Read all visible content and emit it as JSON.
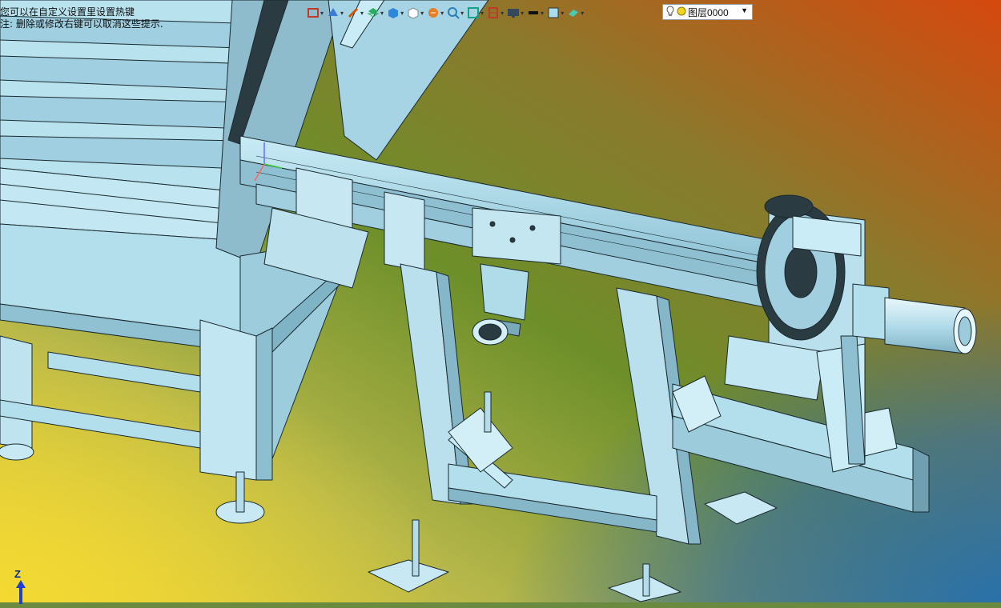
{
  "hint": {
    "line1": "您可以在自定义设置里设置热键",
    "line2": "注: 删除或修改右键可以取消这些提示."
  },
  "toolbar": {
    "items": [
      {
        "name": "render-mode-icon",
        "color": "#c0392b"
      },
      {
        "name": "view-orient-icon",
        "color": "#3a7bd5"
      },
      {
        "name": "sketch-pen-icon",
        "color": "#d35400"
      },
      {
        "name": "layer-stack-icon",
        "color": "#27ae60"
      },
      {
        "name": "solid-cube-icon",
        "color": "#2e86de"
      },
      {
        "name": "wire-cube-icon",
        "color": "#7f8c8d"
      },
      {
        "name": "filter-icon",
        "color": "#e67e22"
      },
      {
        "name": "zoom-fit-icon",
        "color": "#2980b9"
      },
      {
        "name": "zoom-box-icon",
        "color": "#16a085"
      },
      {
        "name": "section-view-icon",
        "color": "#c0392b"
      },
      {
        "name": "display-monitor-icon",
        "color": "#34495e"
      },
      {
        "name": "line-style-icon",
        "color": "#111111"
      },
      {
        "name": "color-swatch-icon",
        "color": "#a9dcef"
      },
      {
        "name": "material-icon",
        "color": "#48c9b0"
      }
    ]
  },
  "layer": {
    "label": "图层0000"
  },
  "axis": {
    "z_label": "Z"
  },
  "colors": {
    "part_face": "#a8d8e8",
    "part_edge": "#1a2a30"
  }
}
